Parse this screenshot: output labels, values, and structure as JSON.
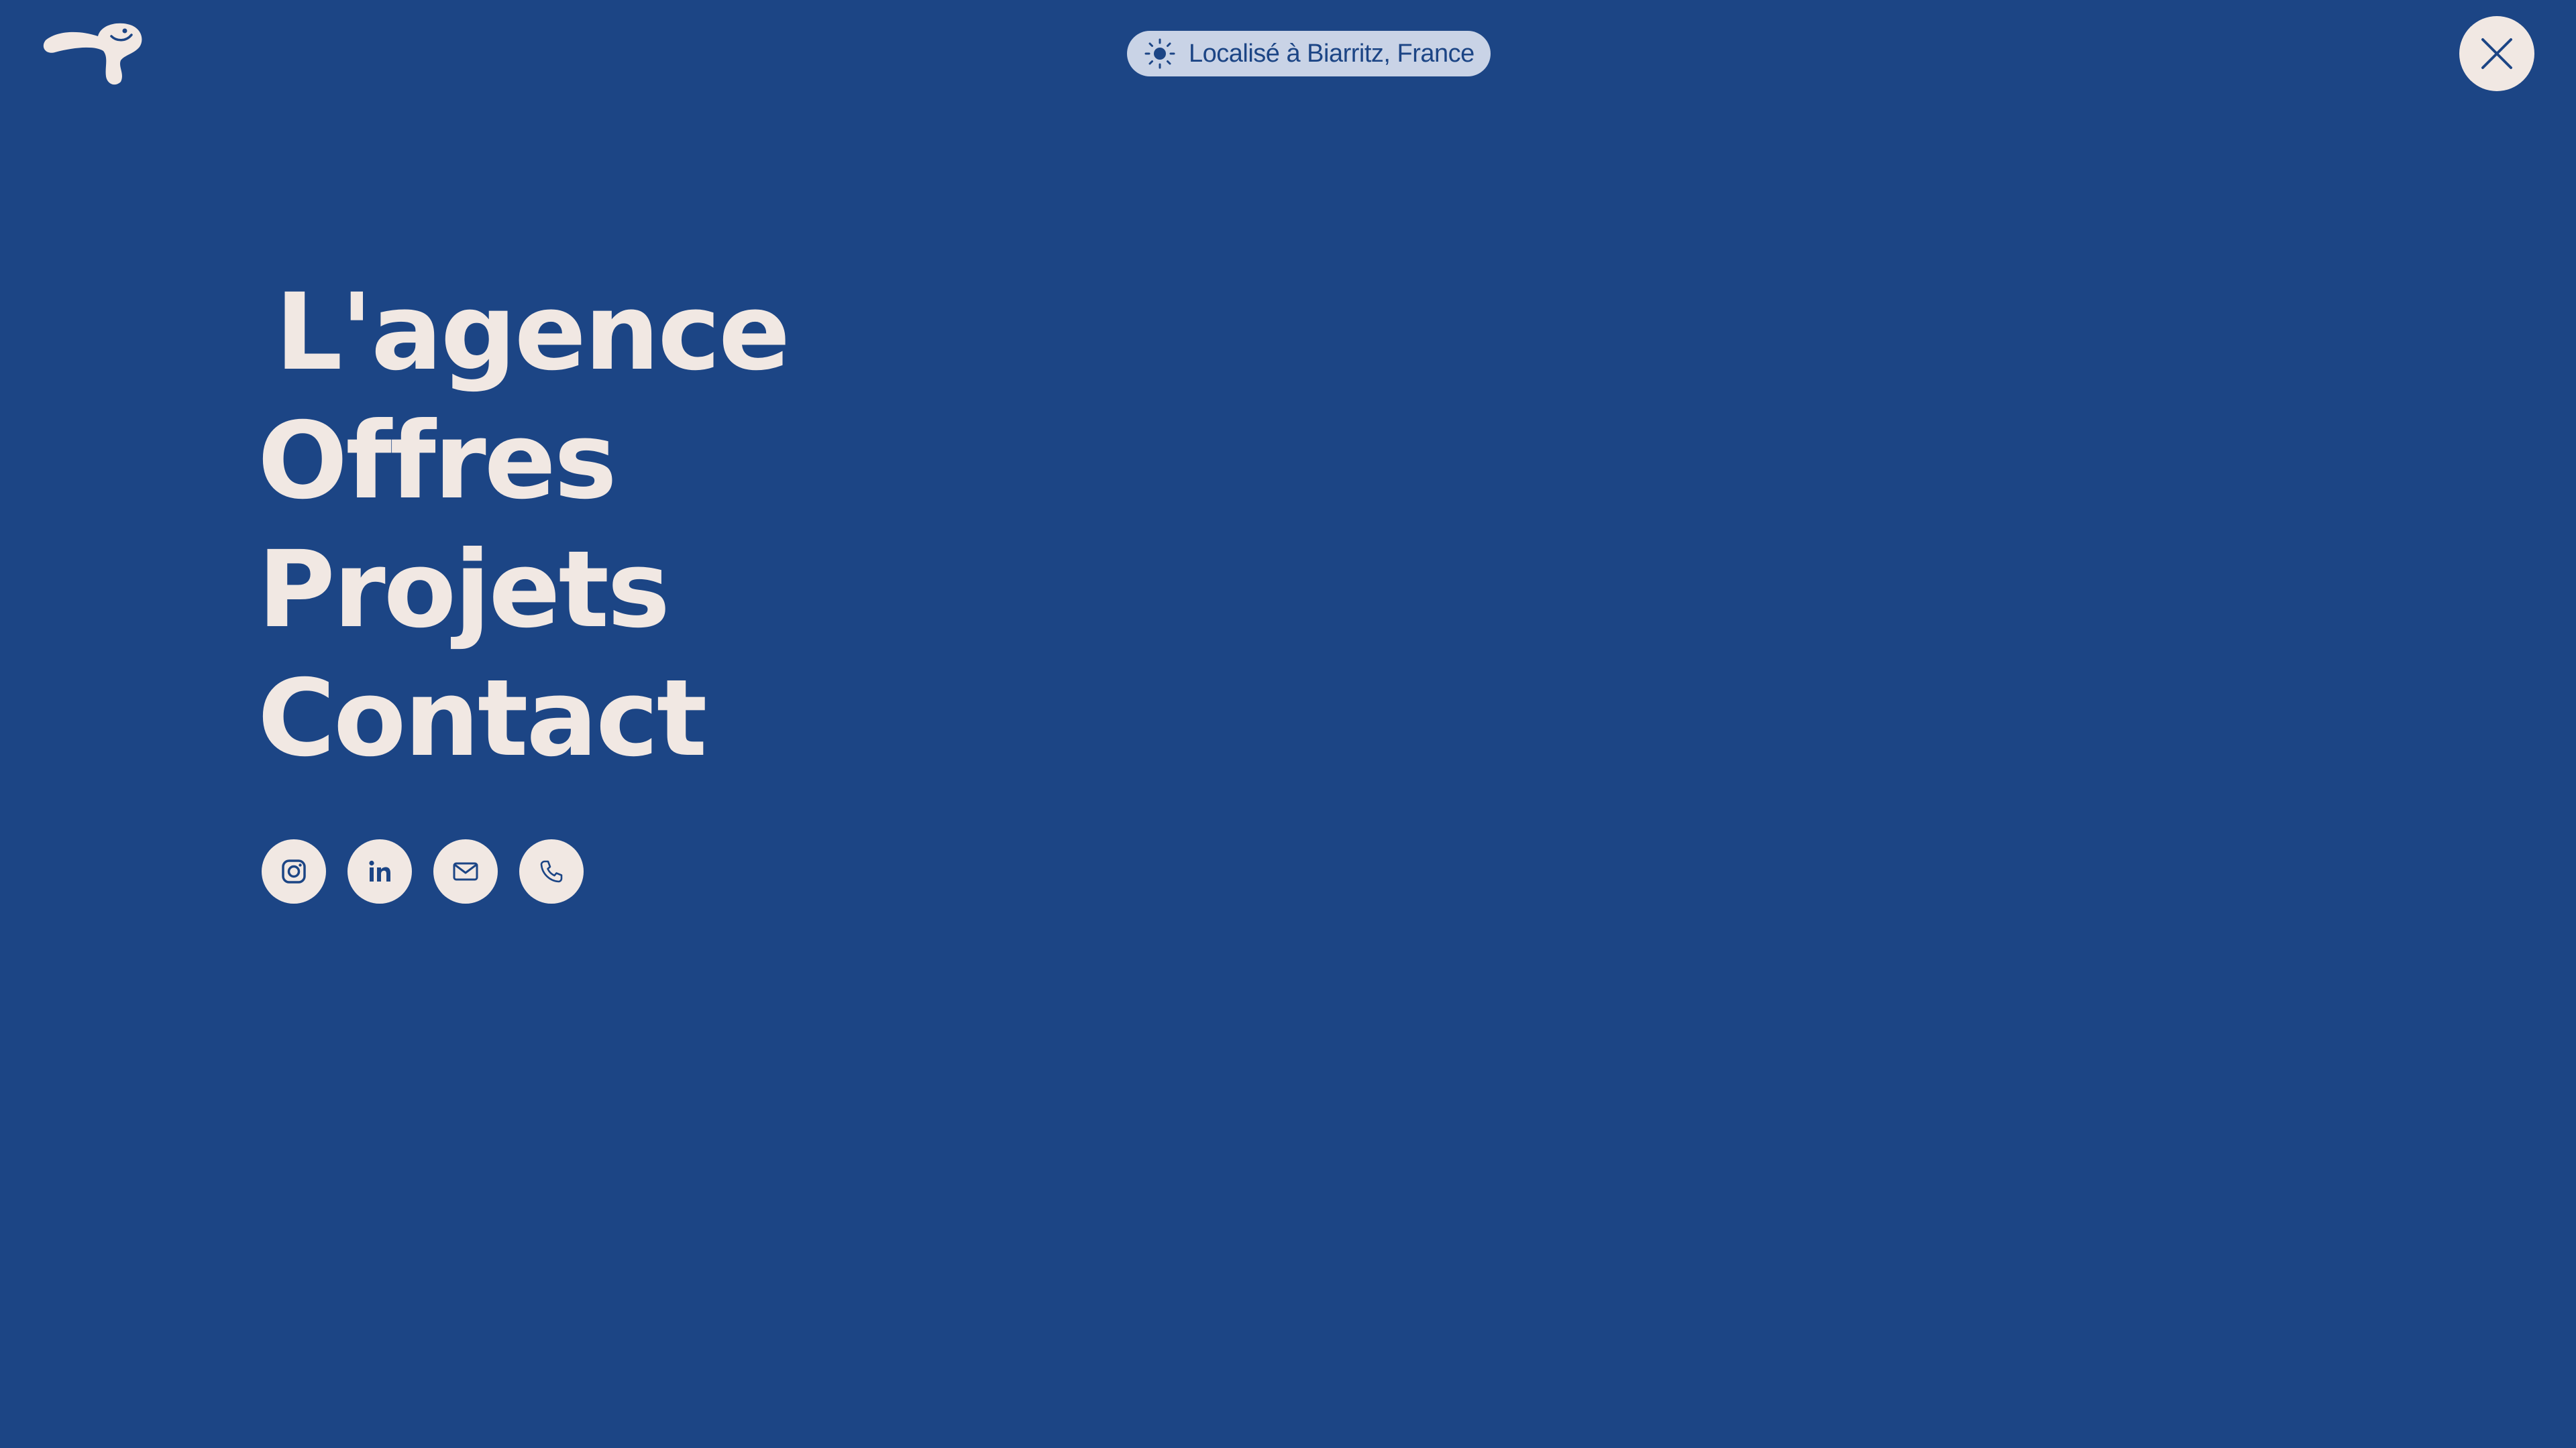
{
  "header": {
    "logo_icon": "brand-mascot-logo",
    "location": {
      "icon": "sun-icon",
      "text": "Localisé à Biarritz, France"
    },
    "close_icon": "close-icon"
  },
  "menu": {
    "items": [
      {
        "label": "L'agence"
      },
      {
        "label": "Offres"
      },
      {
        "label": "Projets"
      },
      {
        "label": "Contact"
      }
    ]
  },
  "socials": [
    {
      "icon": "instagram-icon"
    },
    {
      "icon": "linkedin-icon"
    },
    {
      "icon": "mail-icon"
    },
    {
      "icon": "phone-icon"
    }
  ],
  "colors": {
    "background": "#1c4585",
    "foreground": "#f1e8e3",
    "pill_background": "#c9d3e6"
  }
}
